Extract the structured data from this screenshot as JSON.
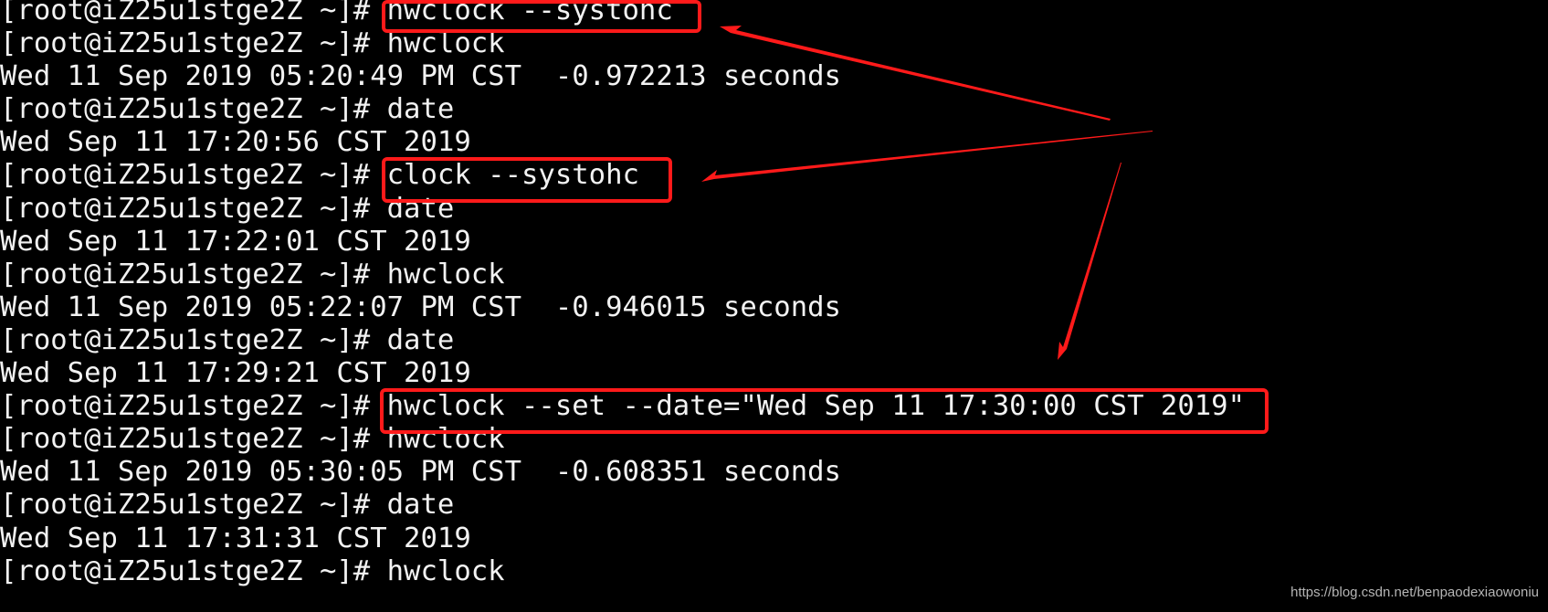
{
  "terminal": {
    "prompt": "[root@iZ25u1stge2Z ~]# ",
    "lines": [
      {
        "type": "cmd",
        "text": "hwclock --systohc"
      },
      {
        "type": "cmd",
        "text": "hwclock"
      },
      {
        "type": "out",
        "text": "Wed 11 Sep 2019 05:20:49 PM CST  -0.972213 seconds"
      },
      {
        "type": "cmd",
        "text": "date"
      },
      {
        "type": "out",
        "text": "Wed Sep 11 17:20:56 CST 2019"
      },
      {
        "type": "cmd",
        "text": "clock --systohc"
      },
      {
        "type": "cmd",
        "text": "date"
      },
      {
        "type": "out",
        "text": "Wed Sep 11 17:22:01 CST 2019"
      },
      {
        "type": "cmd",
        "text": "hwclock"
      },
      {
        "type": "out",
        "text": "Wed 11 Sep 2019 05:22:07 PM CST  -0.946015 seconds"
      },
      {
        "type": "cmd",
        "text": "date"
      },
      {
        "type": "out",
        "text": "Wed Sep 11 17:29:21 CST 2019"
      },
      {
        "type": "cmd",
        "text": "hwclock --set --date=\"Wed Sep 11 17:30:00 CST 2019\""
      },
      {
        "type": "cmd",
        "text": "hwclock"
      },
      {
        "type": "out",
        "text": "Wed 11 Sep 2019 05:30:05 PM CST  -0.608351 seconds"
      },
      {
        "type": "cmd",
        "text": "date"
      },
      {
        "type": "out",
        "text": "Wed Sep 11 17:31:31 CST 2019"
      },
      {
        "type": "cmd",
        "text": "hwclock"
      }
    ]
  },
  "annotations": {
    "color": "#ff1a1a",
    "highlighted_commands": [
      "hwclock --systohc",
      "clock --systohc",
      "hwclock --set --date=\"Wed Sep 11 17:30:00 CST 2019\""
    ]
  },
  "watermark": "https://blog.csdn.net/benpaodexiaowoniu"
}
